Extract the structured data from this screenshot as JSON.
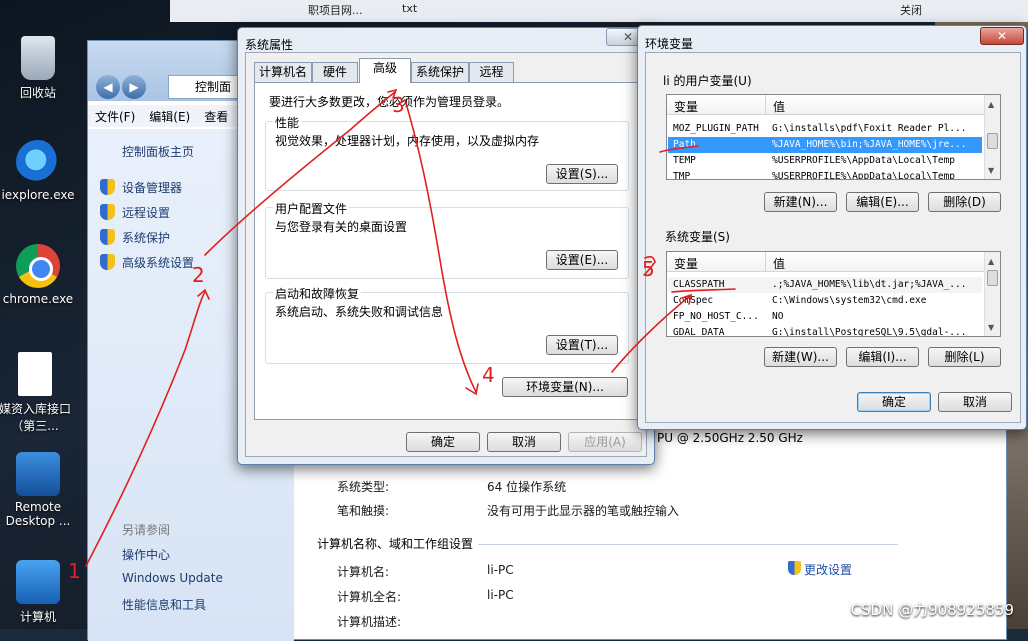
{
  "desktop": {
    "icons": [
      {
        "label": "回收站",
        "icon": "recycle-bin-icon"
      },
      {
        "label": "iexplore.exe",
        "icon": "ie-icon"
      },
      {
        "label": "chrome.exe",
        "icon": "chrome-icon"
      },
      {
        "label": "媒资入库接口（第三...",
        "icon": "document-icon"
      },
      {
        "label": "Remote Desktop ...",
        "icon": "remote-desktop-icon"
      },
      {
        "label": "计算机",
        "icon": "computer-icon"
      }
    ],
    "top_strip": [
      "职项目网...",
      "txt",
      "关闭"
    ],
    "watermark": "CSDN @力908925859"
  },
  "control_panel": {
    "address": "控制面",
    "menu": [
      "文件(F)",
      "编辑(E)",
      "查看"
    ],
    "side_links": [
      "控制面板主页",
      "设备管理器",
      "远程设置",
      "系统保护",
      "高级系统设置"
    ],
    "see_also": "另请参阅",
    "see_also_links": [
      "操作中心",
      "Windows Update",
      "性能信息和工具"
    ],
    "cpu_info": "PU @ 2.50GHz   2.50 GHz",
    "rows": [
      {
        "label": "系统类型:",
        "value": "64 位操作系统"
      },
      {
        "label": "笔和触摸:",
        "value": "没有可用于此显示器的笔或触控输入"
      }
    ],
    "section_title": "计算机名称、域和工作组设置",
    "name_rows": [
      {
        "label": "计算机名:",
        "value": "li-PC"
      },
      {
        "label": "计算机全名:",
        "value": "li-PC"
      },
      {
        "label": "计算机描述:",
        "value": ""
      }
    ],
    "change_settings": "更改设置"
  },
  "system_properties": {
    "title": "系统属性",
    "tabs": [
      "计算机名",
      "硬件",
      "高级",
      "系统保护",
      "远程"
    ],
    "active_tab": "高级",
    "admin_note": "要进行大多数更改，您必须作为管理员登录。",
    "groups": [
      {
        "title": "性能",
        "desc": "视觉效果，处理器计划，内存使用，以及虚拟内存",
        "button": "设置(S)..."
      },
      {
        "title": "用户配置文件",
        "desc": "与您登录有关的桌面设置",
        "button": "设置(E)..."
      },
      {
        "title": "启动和故障恢复",
        "desc": "系统启动、系统失败和调试信息",
        "button": "设置(T)..."
      }
    ],
    "env_button": "环境变量(N)...",
    "ok": "确定",
    "cancel": "取消",
    "apply": "应用(A)"
  },
  "env_vars": {
    "title": "环境变量",
    "user_section": "li 的用户变量(U)",
    "col_var": "变量",
    "col_val": "值",
    "user_vars": [
      {
        "name": "MOZ_PLUGIN_PATH",
        "value": "G:\\installs\\pdf\\Foxit Reader Pl..."
      },
      {
        "name": "Path",
        "value": "%JAVA_HOME%\\bin;%JAVA_HOME%\\jre..."
      },
      {
        "name": "TEMP",
        "value": "%USERPROFILE%\\AppData\\Local\\Temp"
      },
      {
        "name": "TMP",
        "value": "%USERPROFILE%\\AppData\\Local\\Temp"
      }
    ],
    "user_buttons": [
      "新建(N)...",
      "编辑(E)...",
      "删除(D)"
    ],
    "system_section": "系统变量(S)",
    "system_vars": [
      {
        "name": "CLASSPATH",
        "value": ".;%JAVA_HOME%\\lib\\dt.jar;%JAVA_..."
      },
      {
        "name": "ComSpec",
        "value": "C:\\Windows\\system32\\cmd.exe"
      },
      {
        "name": "FP_NO_HOST_C...",
        "value": "NO"
      },
      {
        "name": "GDAL_DATA",
        "value": "G:\\install\\PostgreSQL\\9.5\\gdal-..."
      }
    ],
    "system_buttons": [
      "新建(W)...",
      "编辑(I)...",
      "删除(L)"
    ],
    "ok": "确定",
    "cancel": "取消"
  },
  "annotations": [
    "1",
    "2",
    "3",
    "4",
    "5"
  ],
  "colors": {
    "selection": "#3399ff",
    "annotation": "#e02020"
  }
}
